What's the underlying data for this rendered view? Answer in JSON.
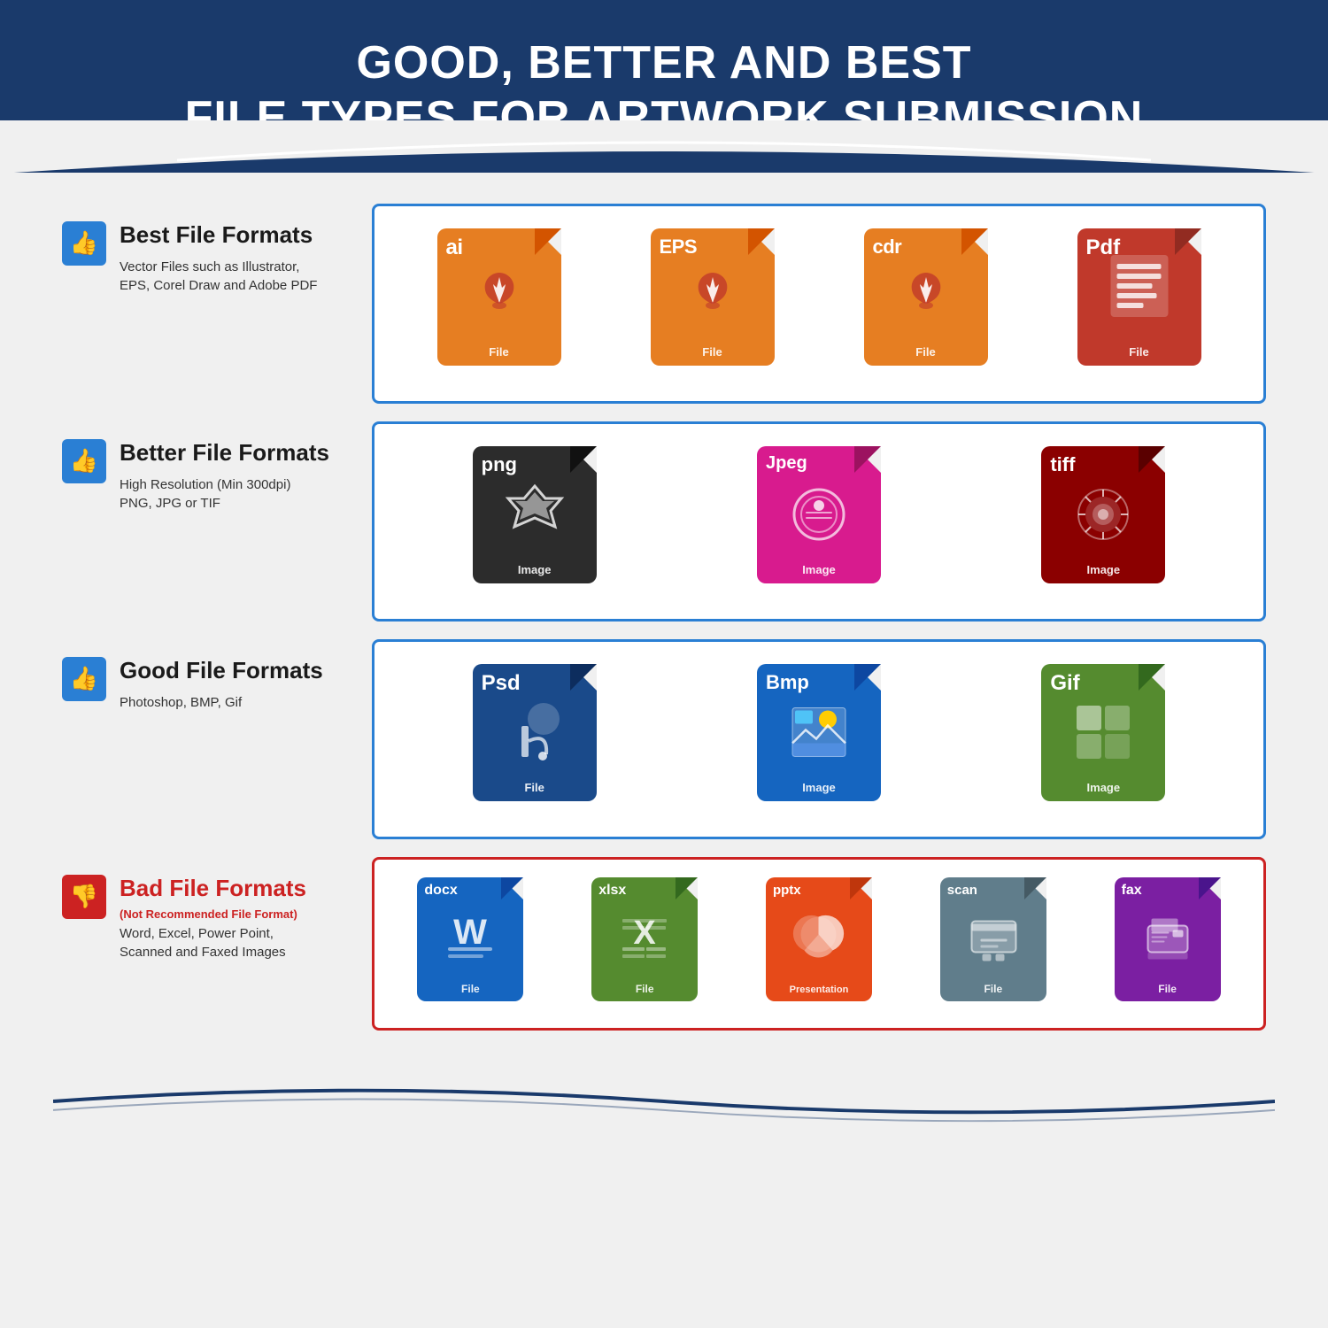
{
  "header": {
    "line1": "GOOD, BETTER AND BEST",
    "line2": "FILE TYPES FOR ARTWORK SUBMISSION"
  },
  "rows": [
    {
      "id": "best",
      "title": "Best File Formats",
      "subtitle": null,
      "description": "Vector Files such as Illustrator,\nEPS, Corel Draw and Adobe PDF",
      "thumb": "up",
      "border_color": "blue",
      "files": [
        {
          "ext": "ai",
          "label": "File",
          "color": "orange",
          "icon": "pen"
        },
        {
          "ext": "EPS",
          "label": "File",
          "color": "orange",
          "icon": "pen"
        },
        {
          "ext": "cdr",
          "label": "File",
          "color": "orange",
          "icon": "pen"
        },
        {
          "ext": "Pdf",
          "label": "File",
          "color": "red",
          "icon": "doc"
        }
      ]
    },
    {
      "id": "better",
      "title": "Better File Formats",
      "subtitle": null,
      "description": "High Resolution (Min 300dpi)\nPNG, JPG or TIF",
      "thumb": "up",
      "border_color": "blue",
      "files": [
        {
          "ext": "png",
          "label": "Image",
          "color": "black",
          "icon": "star"
        },
        {
          "ext": "Jpeg",
          "label": "Image",
          "color": "pink",
          "icon": "camera"
        },
        {
          "ext": "tiff",
          "label": "Image",
          "color": "crimson",
          "icon": "flower"
        }
      ]
    },
    {
      "id": "good",
      "title": "Good File Formats",
      "subtitle": null,
      "description": "Photoshop, BMP, Gif",
      "thumb": "up",
      "border_color": "blue",
      "files": [
        {
          "ext": "Psd",
          "label": "File",
          "color": "dark-blue",
          "icon": "brush"
        },
        {
          "ext": "Bmp",
          "label": "Image",
          "color": "bright-blue",
          "icon": "mountain"
        },
        {
          "ext": "Gif",
          "label": "Image",
          "color": "green",
          "icon": "grid"
        }
      ]
    },
    {
      "id": "bad",
      "title": "Bad File Formats",
      "subtitle": "(Not Recommended File Format)",
      "description": "Word, Excel, Power Point,\nScanned and Faxed Images",
      "thumb": "down",
      "border_color": "red",
      "files": [
        {
          "ext": "docx",
          "label": "File",
          "color": "blue",
          "icon": "word"
        },
        {
          "ext": "xlsx",
          "label": "File",
          "color": "olive",
          "icon": "excel"
        },
        {
          "ext": "pptx",
          "label": "Presentation",
          "color": "orange-red",
          "icon": "ppt"
        },
        {
          "ext": "scan",
          "label": "File",
          "color": "gray",
          "icon": "scanner"
        },
        {
          "ext": "fax",
          "label": "File",
          "color": "purple",
          "icon": "fax"
        }
      ]
    }
  ]
}
